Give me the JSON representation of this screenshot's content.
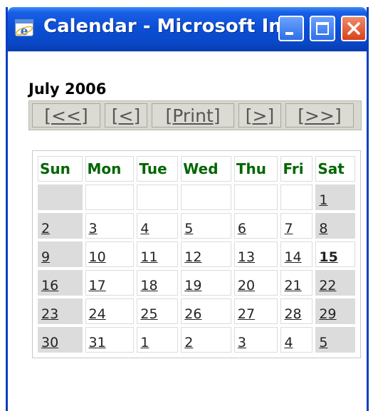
{
  "window": {
    "title": "Calendar - Microsoft In...",
    "icon": "internet-explorer-icon",
    "accent_color": "#0a48c8"
  },
  "calendar": {
    "month_title": "July 2006",
    "nav": {
      "prev_year": "[<<]",
      "prev_month": "[<]",
      "print": "[Print]",
      "next_month": "[>]",
      "next_year": "[>>]"
    },
    "days_of_week": [
      "Sun",
      "Mon",
      "Tue",
      "Wed",
      "Thu",
      "Fri",
      "Sat"
    ],
    "header_color": "#006600",
    "today_color": "#e00000",
    "weeks": [
      [
        "",
        "",
        "",
        "",
        "",
        "",
        "1"
      ],
      [
        "2",
        "3",
        "4",
        "5",
        "6",
        "7",
        "8"
      ],
      [
        "9",
        "10",
        "11",
        "12",
        "13",
        "14",
        "15"
      ],
      [
        "16",
        "17",
        "18",
        "19",
        "20",
        "21",
        "22"
      ],
      [
        "23",
        "24",
        "25",
        "26",
        "27",
        "28",
        "29"
      ],
      [
        "30",
        "31",
        "1",
        "2",
        "3",
        "4",
        "5"
      ]
    ],
    "today": "15",
    "next_month_days": [
      "1",
      "2",
      "3",
      "4",
      "5"
    ]
  }
}
